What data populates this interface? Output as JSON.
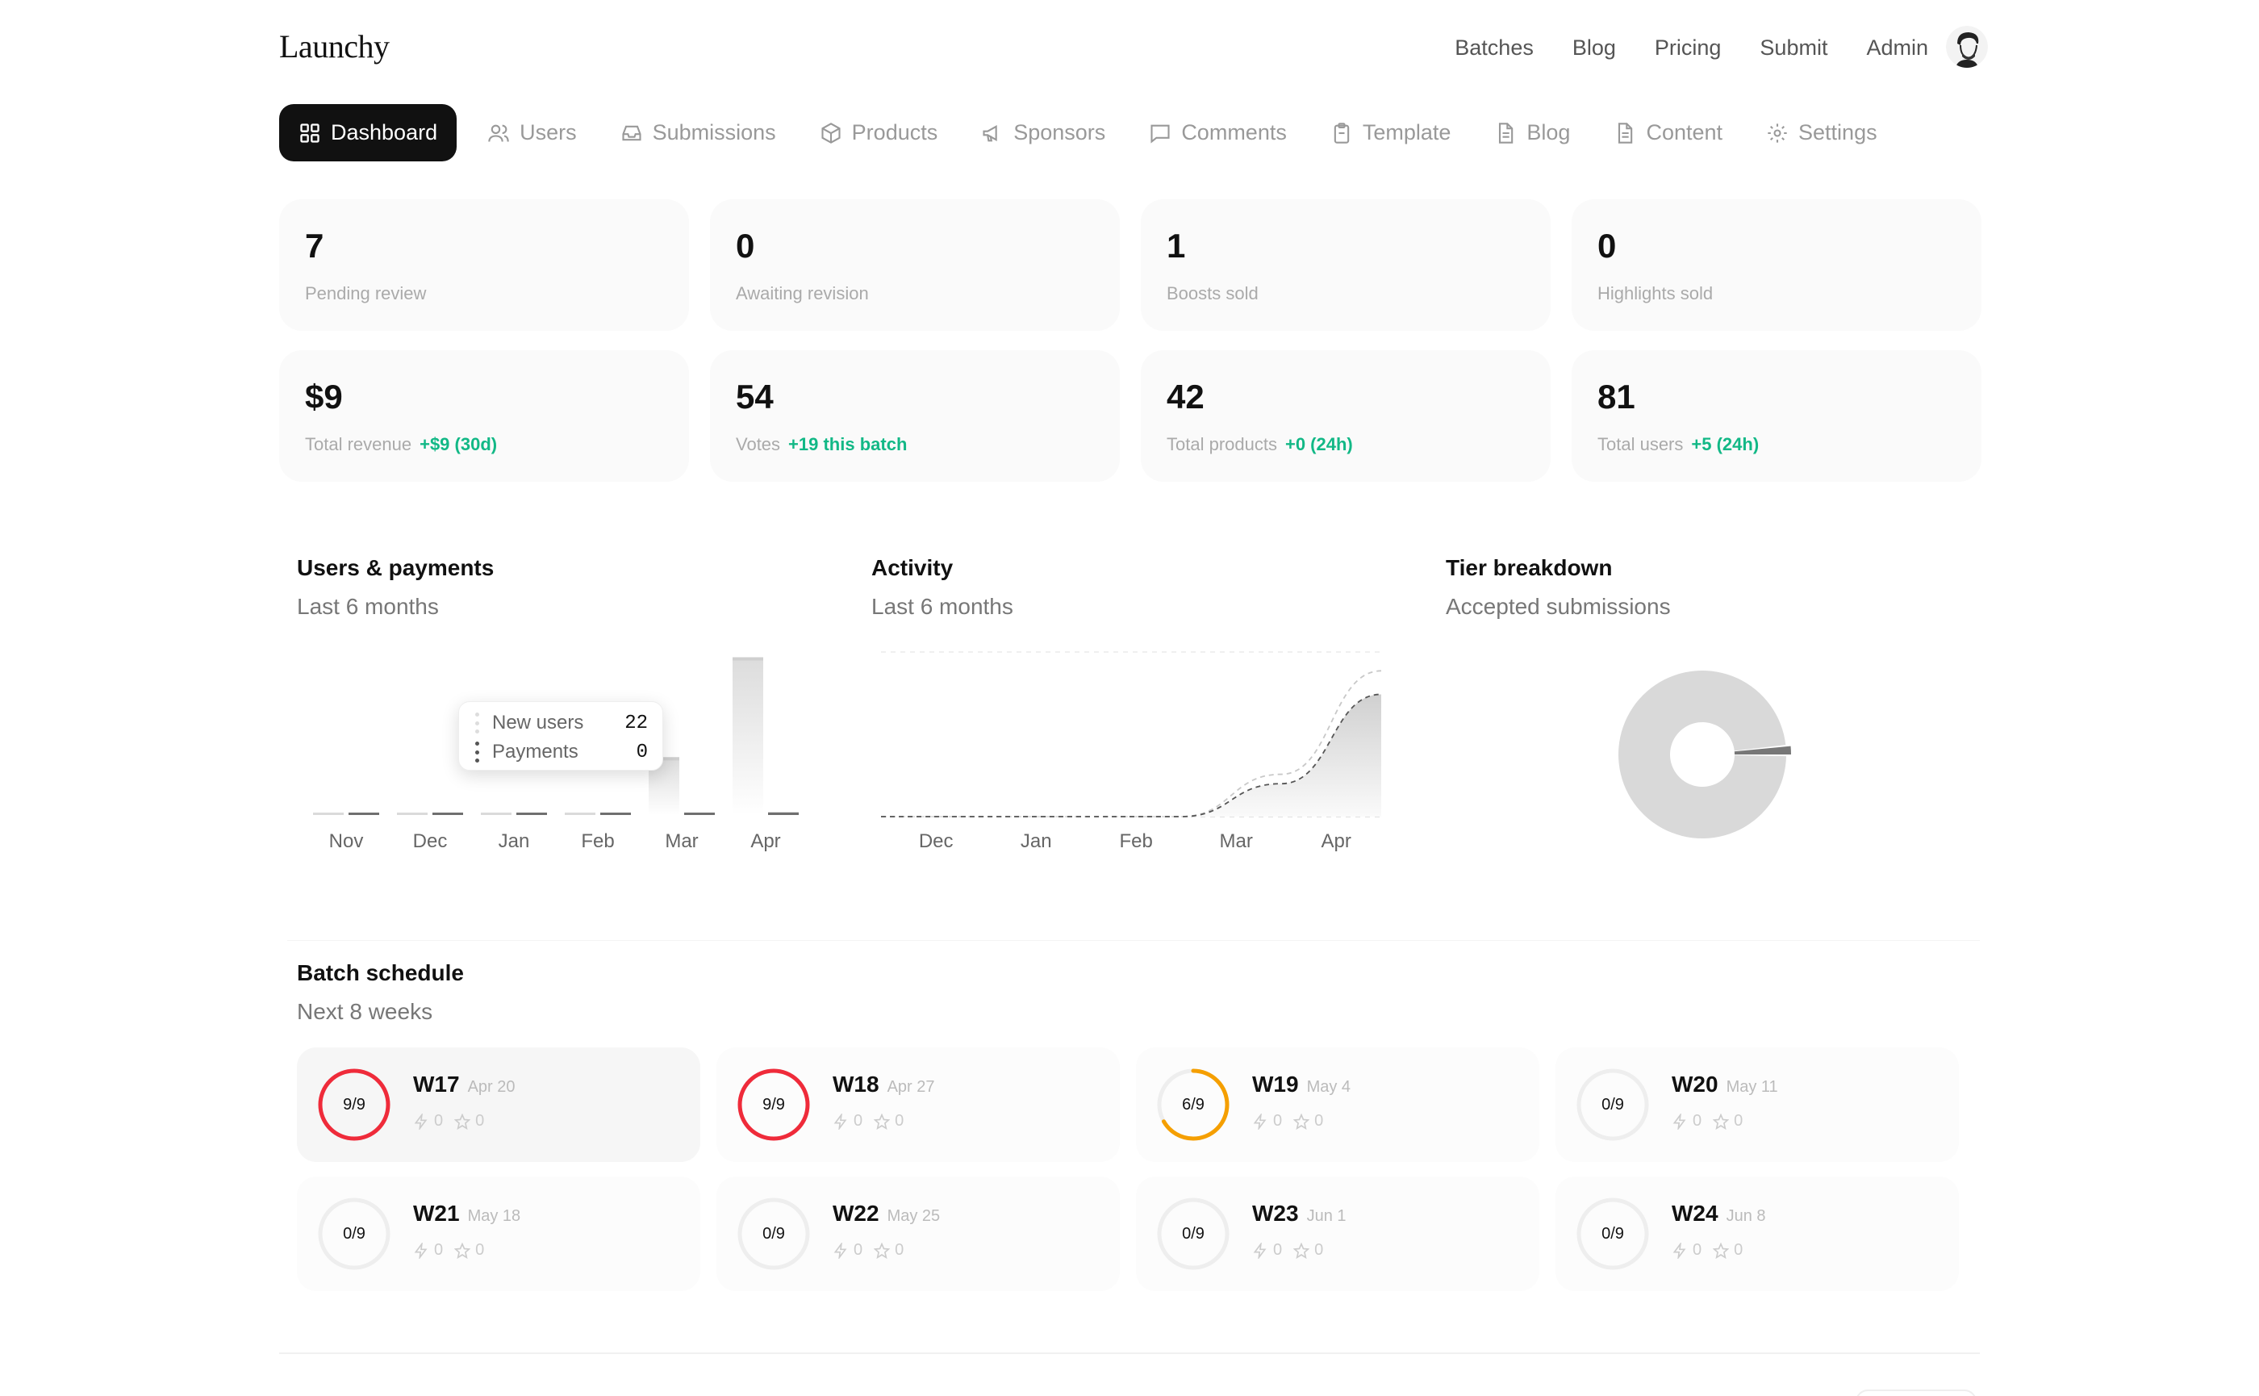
{
  "brand": "Launchy",
  "topnav": [
    "Batches",
    "Blog",
    "Pricing",
    "Submit",
    "Admin"
  ],
  "tabs": [
    {
      "label": "Dashboard",
      "icon": "dashboard-icon",
      "active": true
    },
    {
      "label": "Users",
      "icon": "users-icon"
    },
    {
      "label": "Submissions",
      "icon": "inbox-icon"
    },
    {
      "label": "Products",
      "icon": "package-icon"
    },
    {
      "label": "Sponsors",
      "icon": "megaphone-icon"
    },
    {
      "label": "Comments",
      "icon": "comment-icon"
    },
    {
      "label": "Template",
      "icon": "clipboard-icon"
    },
    {
      "label": "Blog",
      "icon": "document-icon"
    },
    {
      "label": "Content",
      "icon": "document-icon"
    },
    {
      "label": "Settings",
      "icon": "gear-icon"
    }
  ],
  "stats_top": [
    {
      "value": "7",
      "label": "Pending review"
    },
    {
      "value": "0",
      "label": "Awaiting revision"
    },
    {
      "value": "1",
      "label": "Boosts sold"
    },
    {
      "value": "0",
      "label": "Highlights sold"
    }
  ],
  "stats_bottom": [
    {
      "value": "$9",
      "label": "Total revenue",
      "delta": "+$9 (30d)"
    },
    {
      "value": "54",
      "label": "Votes",
      "delta": "+19 this batch"
    },
    {
      "value": "42",
      "label": "Total products",
      "delta": "+0 (24h)"
    },
    {
      "value": "81",
      "label": "Total users",
      "delta": "+5 (24h)"
    }
  ],
  "colors": {
    "accent": "#111111",
    "positive": "#12b886",
    "full": "#ef2b3a",
    "partial": "#f59f00",
    "empty": "#eeeeee"
  },
  "charts": {
    "users": {
      "title": "Users & payments",
      "subtitle": "Last 6 months"
    },
    "activity": {
      "title": "Activity",
      "subtitle": "Last 6 months"
    },
    "tiers": {
      "title": "Tier breakdown",
      "subtitle": "Accepted submissions"
    }
  },
  "tooltip": {
    "rows": [
      {
        "label": "New users",
        "value": "22"
      },
      {
        "label": "Payments",
        "value": "0"
      }
    ]
  },
  "chart_data": [
    {
      "type": "bar",
      "categories": [
        "Nov",
        "Dec",
        "Jan",
        "Feb",
        "Mar",
        "Apr"
      ],
      "series": [
        {
          "name": "New users",
          "values": [
            0,
            0,
            0,
            0,
            22,
            60
          ]
        },
        {
          "name": "Payments",
          "values": [
            0,
            0,
            0,
            0,
            0,
            1
          ]
        }
      ],
      "ylim": [
        0,
        62
      ]
    },
    {
      "type": "area",
      "x": [
        "Nov",
        "Dec",
        "Jan",
        "Feb",
        "Mar",
        "Apr"
      ],
      "xticks": [
        "Dec",
        "Jan",
        "Feb",
        "Mar",
        "Apr"
      ],
      "series": [
        {
          "values": [
            0,
            0,
            0,
            0,
            18,
            62
          ]
        },
        {
          "values": [
            0,
            0,
            0,
            0,
            14,
            52
          ]
        }
      ],
      "ylim": [
        0,
        70
      ],
      "grid": true
    },
    {
      "type": "pie",
      "slices": [
        0.985,
        0.015
      ],
      "colors": [
        "#d9d9d9",
        "#777777"
      ],
      "donut": true
    }
  ],
  "batch_section": {
    "title": "Batch schedule",
    "subtitle": "Next 8 weeks"
  },
  "batches": [
    {
      "week": "W17",
      "date": "Apr 20",
      "filled": 9,
      "capacity": 9,
      "ratio": "9/9",
      "boosts": "0",
      "highlights": "0"
    },
    {
      "week": "W18",
      "date": "Apr 27",
      "filled": 9,
      "capacity": 9,
      "ratio": "9/9",
      "boosts": "0",
      "highlights": "0"
    },
    {
      "week": "W19",
      "date": "May 4",
      "filled": 6,
      "capacity": 9,
      "ratio": "6/9",
      "boosts": "0",
      "highlights": "0"
    },
    {
      "week": "W20",
      "date": "May 11",
      "filled": 0,
      "capacity": 9,
      "ratio": "0/9",
      "boosts": "0",
      "highlights": "0"
    },
    {
      "week": "W21",
      "date": "May 18",
      "filled": 0,
      "capacity": 9,
      "ratio": "0/9",
      "boosts": "0",
      "highlights": "0"
    },
    {
      "week": "W22",
      "date": "May 25",
      "filled": 0,
      "capacity": 9,
      "ratio": "0/9",
      "boosts": "0",
      "highlights": "0"
    },
    {
      "week": "W23",
      "date": "Jun 1",
      "filled": 0,
      "capacity": 9,
      "ratio": "0/9",
      "boosts": "0",
      "highlights": "0"
    },
    {
      "week": "W24",
      "date": "Jun 8",
      "filled": 0,
      "capacity": 9,
      "ratio": "0/9",
      "boosts": "0",
      "highlights": "0"
    }
  ]
}
